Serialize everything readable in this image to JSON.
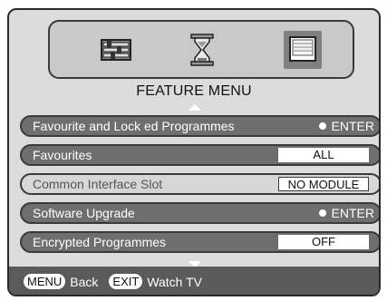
{
  "icons": [
    "settings-sliders-icon",
    "hourglass-icon",
    "tv-screen-icon"
  ],
  "menu": {
    "title": "FEATURE MENU"
  },
  "rows": [
    {
      "label": "Favourite and Lock  ed Programmes",
      "value": "ENTER",
      "kind": "enter",
      "state": "active"
    },
    {
      "label": "Favourites",
      "value": "ALL",
      "kind": "box",
      "state": "active"
    },
    {
      "label": "Common Interface Slot",
      "value": "NO MODULE",
      "kind": "box",
      "state": "disabled"
    },
    {
      "label": "Software Upgrade",
      "value": "ENTER",
      "kind": "enter",
      "state": "active"
    },
    {
      "label": "Encrypted Programmes",
      "value": "OFF",
      "kind": "box",
      "state": "active"
    }
  ],
  "footer": {
    "key1": "MENU",
    "label1": "Back",
    "key2": "EXIT",
    "label2": "Watch TV"
  },
  "colors": {
    "panel_bg": "#dcdcdc",
    "row_active": "#6e6e6e",
    "footer_bg": "#5a5a5a"
  }
}
